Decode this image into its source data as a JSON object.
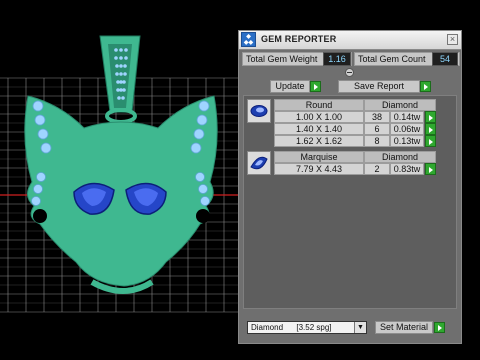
{
  "window": {
    "title": "GEM REPORTER",
    "icon": "gem-reporter-app-icon",
    "close_symbol": "×"
  },
  "totals": {
    "weight_label": "Total Gem Weight",
    "weight_value": "1.16",
    "count_label": "Total Gem Count",
    "count_value": "54"
  },
  "actions": {
    "update_label": "Update",
    "save_report_label": "Save Report"
  },
  "groups": [
    {
      "shape": "Round",
      "material": "Diamond",
      "icon": "round-gem-icon",
      "rows": [
        {
          "size": "1.00 X 1.00",
          "count": "38",
          "weight": "0.14tw"
        },
        {
          "size": "1.40 X 1.40",
          "count": "6",
          "weight": "0.06tw"
        },
        {
          "size": "1.62 X 1.62",
          "count": "8",
          "weight": "0.13tw"
        }
      ]
    },
    {
      "shape": "Marquise",
      "material": "Diamond",
      "icon": "marquise-gem-icon",
      "rows": [
        {
          "size": "7.79 X 4.43",
          "count": "2",
          "weight": "0.83tw"
        }
      ]
    }
  ],
  "material_select": {
    "value": "Diamond      [3.52 spg]"
  },
  "set_material_label": "Set Material",
  "colors": {
    "model_green": "#3fb890",
    "gem_blue": "#2546c8",
    "stone_light": "#9fd4ff",
    "grid": "#8a8a8a"
  }
}
